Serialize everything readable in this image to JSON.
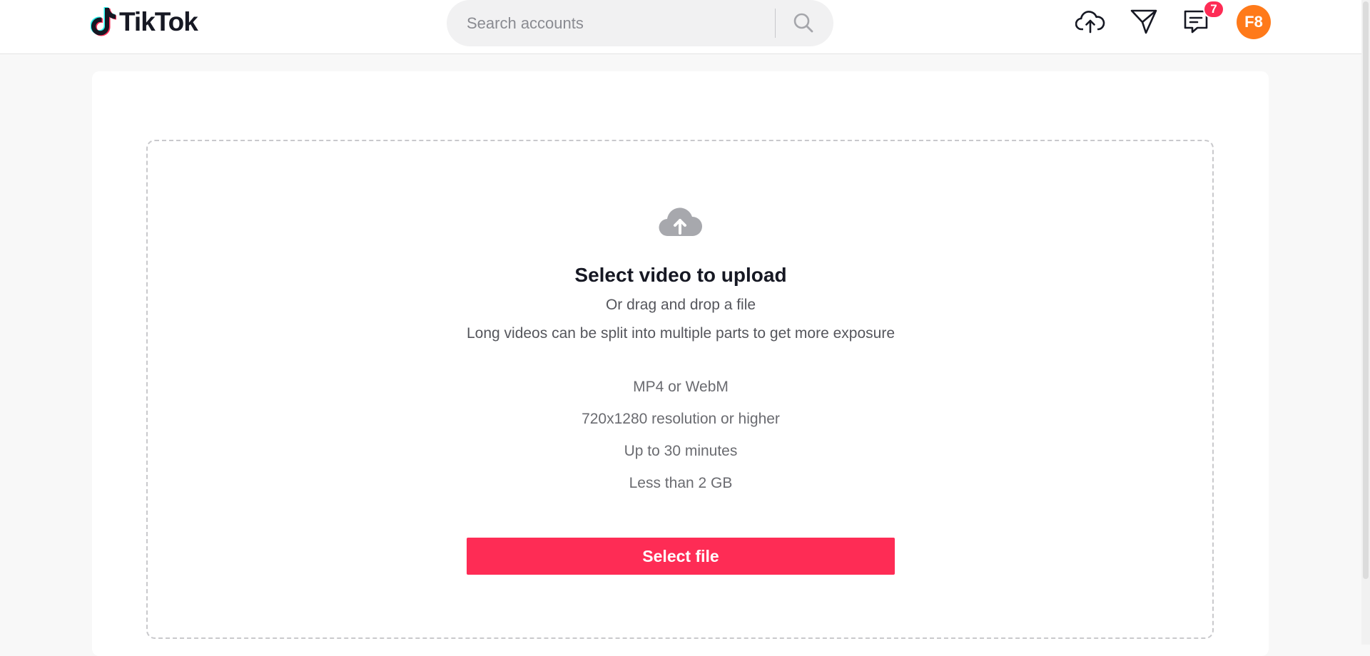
{
  "header": {
    "brand": "TikTok",
    "search": {
      "placeholder": "Search accounts"
    },
    "icons": [
      "upload-icon",
      "send-icon",
      "inbox-icon"
    ],
    "inbox_badge": "7",
    "avatar_initials": "F8"
  },
  "upload": {
    "title": "Select video to upload",
    "drag_text": "Or drag and drop a file",
    "split_text": "Long videos can be split into multiple parts to get more exposure",
    "specs": [
      "MP4 or WebM",
      "720x1280 resolution or higher",
      "Up to 30 minutes",
      "Less than 2 GB"
    ],
    "button_label": "Select file"
  },
  "colors": {
    "accent": "#fe2c55",
    "avatar": "#ff7a1a",
    "text": "#161823"
  }
}
